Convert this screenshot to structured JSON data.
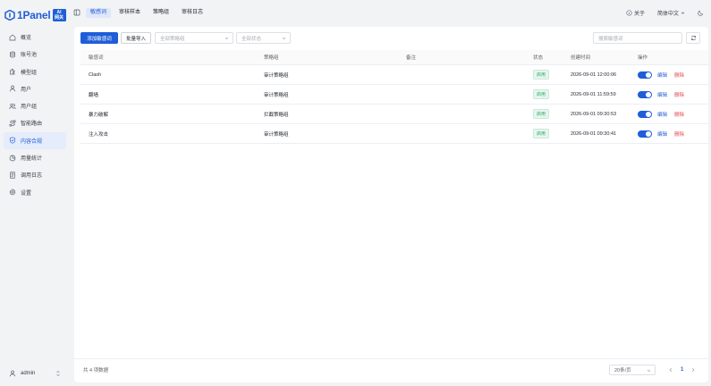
{
  "brand": {
    "name": "1Panel",
    "badge_line1": "AI",
    "badge_line2": "网关",
    "color": "#1f5ed8"
  },
  "sidebar": {
    "items": [
      {
        "label": "概览",
        "icon": "home-icon"
      },
      {
        "label": "账号池",
        "icon": "database-icon"
      },
      {
        "label": "模型组",
        "icon": "puzzle-icon"
      },
      {
        "label": "用户",
        "icon": "user-icon"
      },
      {
        "label": "用户组",
        "icon": "users-icon"
      },
      {
        "label": "智能路由",
        "icon": "route-icon"
      },
      {
        "label": "内容合规",
        "icon": "shield-icon",
        "active": true
      },
      {
        "label": "用量统计",
        "icon": "pie-chart-icon"
      },
      {
        "label": "调用日志",
        "icon": "log-icon"
      },
      {
        "label": "设置",
        "icon": "gear-icon"
      }
    ],
    "user": {
      "name": "admin"
    }
  },
  "header": {
    "tabs": [
      {
        "label": "敏感词",
        "active": true
      },
      {
        "label": "审核样本"
      },
      {
        "label": "策略组"
      },
      {
        "label": "审核日志"
      }
    ],
    "about": "关于",
    "language": "简体中文"
  },
  "toolbar": {
    "add_label": "添加敏感词",
    "import_label": "批量导入",
    "strategy_filter": "全部策略组",
    "status_filter": "全部状态",
    "search_placeholder": "搜索敏感词"
  },
  "table": {
    "columns": [
      "敏感词",
      "策略组",
      "备注",
      "状态",
      "创建时间",
      "操作"
    ],
    "rows": [
      {
        "word": "Clash",
        "group": "审计策略组",
        "note": "",
        "status": "启用",
        "created": "2026-09-01 12:00:06",
        "edit": "编辑",
        "delete": "删除"
      },
      {
        "word": "翻墙",
        "group": "审计策略组",
        "note": "",
        "status": "启用",
        "created": "2026-09-01 11:59:59",
        "edit": "编辑",
        "delete": "删除"
      },
      {
        "word": "暴力破解",
        "group": "拦截策略组",
        "note": "",
        "status": "启用",
        "created": "2026-09-01 09:30:53",
        "edit": "编辑",
        "delete": "删除"
      },
      {
        "word": "注入攻击",
        "group": "审计策略组",
        "note": "",
        "status": "启用",
        "created": "2026-09-01 09:30:41",
        "edit": "编辑",
        "delete": "删除"
      }
    ]
  },
  "footer": {
    "total": "共 4 项数据",
    "page_size": "20条/页",
    "current_page": "1"
  }
}
